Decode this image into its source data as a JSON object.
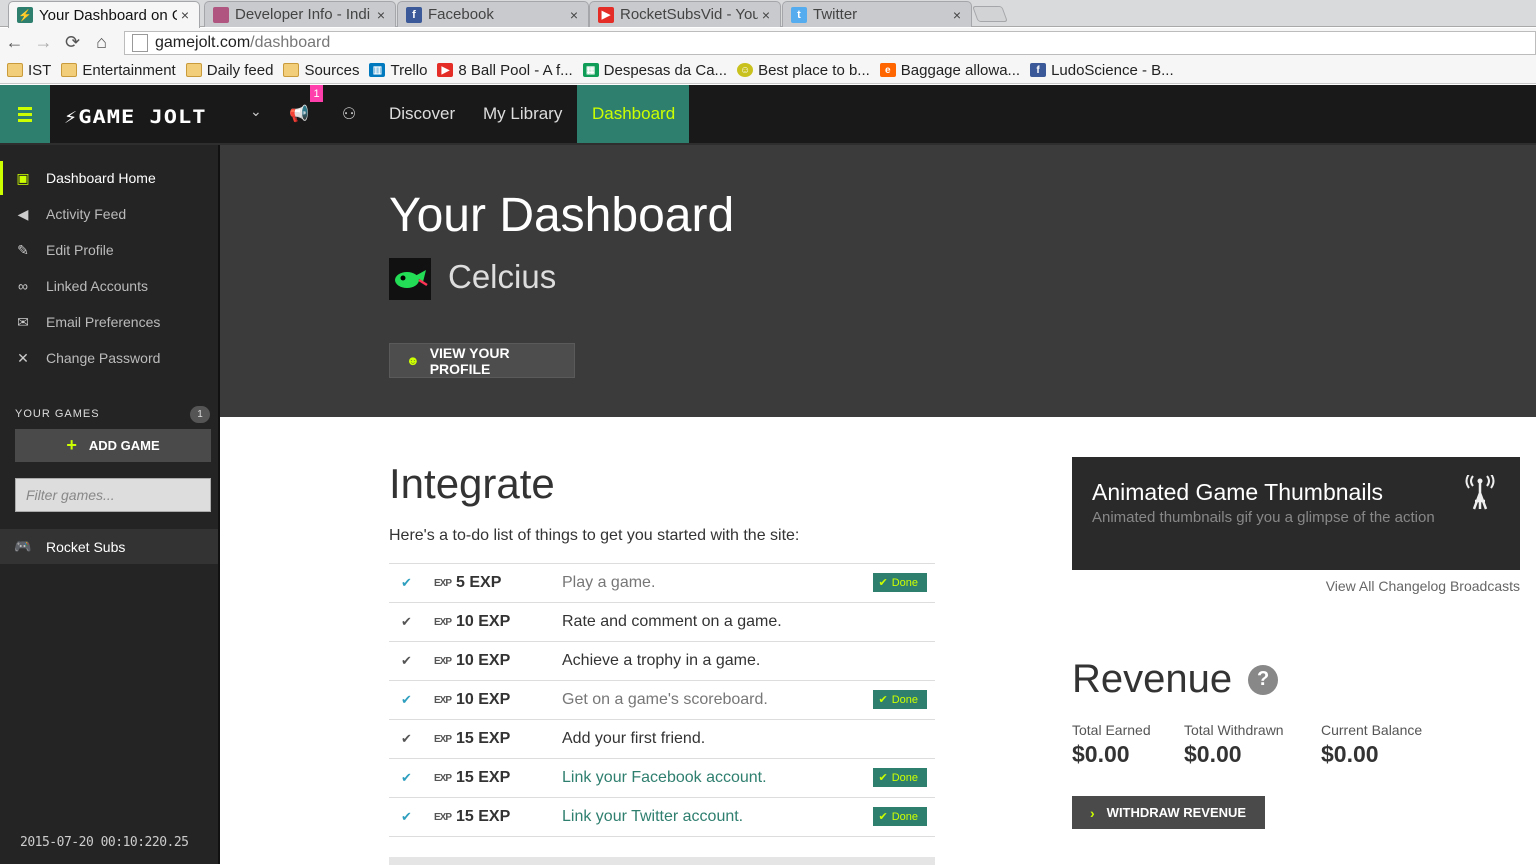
{
  "browser": {
    "tabs": [
      {
        "title": "Your Dashboard on G",
        "favicon_color": "#2f7f6f",
        "icon": "gamejolt-icon"
      },
      {
        "title": "Developer Info - Indi",
        "favicon_color": "#b0557f",
        "icon": "indiedb-icon"
      },
      {
        "title": "Facebook",
        "favicon_color": "#3b5998",
        "icon": "facebook-icon"
      },
      {
        "title": "RocketSubsVid - You",
        "favicon_color": "#e52d27",
        "icon": "youtube-icon"
      },
      {
        "title": "Twitter",
        "favicon_color": "#55acee",
        "icon": "twitter-icon"
      }
    ],
    "url_host": "gamejolt.com",
    "url_path": "/dashboard",
    "bookmarks": [
      {
        "label": "IST",
        "icon": "folder-icon"
      },
      {
        "label": "Entertainment",
        "icon": "folder-icon"
      },
      {
        "label": "Daily feed",
        "icon": "folder-icon"
      },
      {
        "label": "Sources",
        "icon": "folder-icon"
      },
      {
        "label": "Trello",
        "icon": "trello-icon"
      },
      {
        "label": "8 Ball Pool - A f...",
        "icon": "youtube-icon"
      },
      {
        "label": "Despesas da Ca...",
        "icon": "sheets-icon"
      },
      {
        "label": "Best place to b...",
        "icon": "smiley-icon"
      },
      {
        "label": "Baggage allowa...",
        "icon": "easyjet-icon"
      },
      {
        "label": "LudoScience - B...",
        "icon": "facebook-icon"
      }
    ]
  },
  "header": {
    "logo": "GAME JOLT",
    "notification_count": "1",
    "nav": [
      "Discover",
      "My Library",
      "Dashboard"
    ]
  },
  "sidebar": {
    "items": [
      {
        "label": "Dashboard Home",
        "icon": "dashboard-icon"
      },
      {
        "label": "Activity Feed",
        "icon": "megaphone-icon"
      },
      {
        "label": "Edit Profile",
        "icon": "pencil-icon"
      },
      {
        "label": "Linked Accounts",
        "icon": "link-icon"
      },
      {
        "label": "Email Preferences",
        "icon": "envelope-icon"
      },
      {
        "label": "Change Password",
        "icon": "tools-icon"
      }
    ],
    "your_games_label": "YOUR GAMES",
    "your_games_count": "1",
    "add_game_label": "ADD GAME",
    "filter_placeholder": "Filter games...",
    "games": [
      "Rocket Subs"
    ],
    "timestamp": "2015-07-20 00:10:220.25"
  },
  "hero": {
    "title": "Your Dashboard",
    "username": "Celcius",
    "view_profile_label": "VIEW YOUR PROFILE"
  },
  "integrate": {
    "title": "Integrate",
    "intro": "Here's a to-do list of things to get you started with the site:",
    "done_label": "Done",
    "tasks": [
      {
        "exp": "5 EXP",
        "task": "Play a game.",
        "done": true
      },
      {
        "exp": "10 EXP",
        "task": "Rate and comment on a game.",
        "done": false
      },
      {
        "exp": "10 EXP",
        "task": "Achieve a trophy in a game.",
        "done": false
      },
      {
        "exp": "10 EXP",
        "task": "Get on a game's scoreboard.",
        "done": true
      },
      {
        "exp": "15 EXP",
        "task": "Add your first friend.",
        "done": false
      },
      {
        "exp": "15 EXP",
        "task": "Link your Facebook account.",
        "done": true
      },
      {
        "exp": "15 EXP",
        "task": "Link your Twitter account.",
        "done": true
      }
    ]
  },
  "changelog": {
    "title": "Animated Game Thumbnails",
    "description": "Animated thumbnails gif you a glimpse of the action",
    "link": "View All Changelog Broadcasts"
  },
  "revenue": {
    "title": "Revenue",
    "stats": [
      {
        "label": "Total Earned",
        "value": "$0.00"
      },
      {
        "label": "Total Withdrawn",
        "value": "$0.00"
      },
      {
        "label": "Current Balance",
        "value": "$0.00"
      }
    ],
    "withdraw_label": "WITHDRAW REVENUE"
  },
  "colors": {
    "accent": "#ccff00",
    "teal": "#2f7f6f",
    "header_bg": "#191919",
    "sidebar_bg": "#242424",
    "hero_bg": "#3b3b3b"
  }
}
